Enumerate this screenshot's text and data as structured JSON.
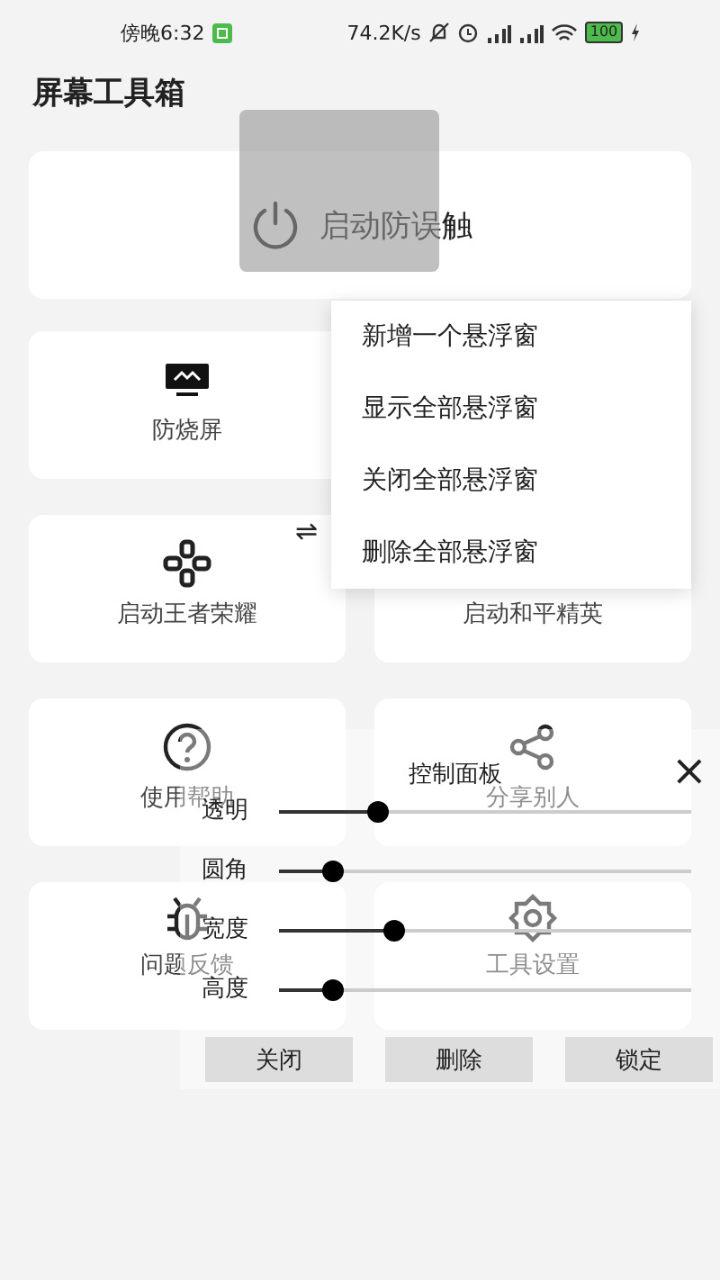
{
  "status_bar": {
    "time": "傍晚6:32",
    "speed": "74.2K/s",
    "battery": "100"
  },
  "title": "屏幕工具箱",
  "main_button": {
    "label": "启动防误触"
  },
  "rows": [
    [
      {
        "kind": "monitor",
        "label": "防烧屏"
      }
    ],
    [
      {
        "kind": "dpad",
        "label": "启动王者荣耀"
      },
      {
        "kind": "plain",
        "label": "启动和平精英"
      }
    ],
    [
      {
        "kind": "help",
        "label": "使用帮助"
      },
      {
        "kind": "share",
        "label": "分享别人"
      }
    ],
    [
      {
        "kind": "bug",
        "label": "问题反馈"
      },
      {
        "kind": "gear",
        "label": "工具设置"
      }
    ]
  ],
  "swap_glyph": "⇌",
  "menu": [
    "新增一个悬浮窗",
    "显示全部悬浮窗",
    "关闭全部悬浮窗",
    "删除全部悬浮窗"
  ],
  "control_panel": {
    "title": "控制面板",
    "close": "×",
    "sliders": [
      {
        "label": "透明",
        "level": 0.24
      },
      {
        "label": "圆角",
        "level": 0.13
      },
      {
        "label": "宽度",
        "level": 0.28
      },
      {
        "label": "高度",
        "level": 0.13
      }
    ],
    "buttons": [
      "关闭",
      "删除",
      "锁定"
    ]
  }
}
